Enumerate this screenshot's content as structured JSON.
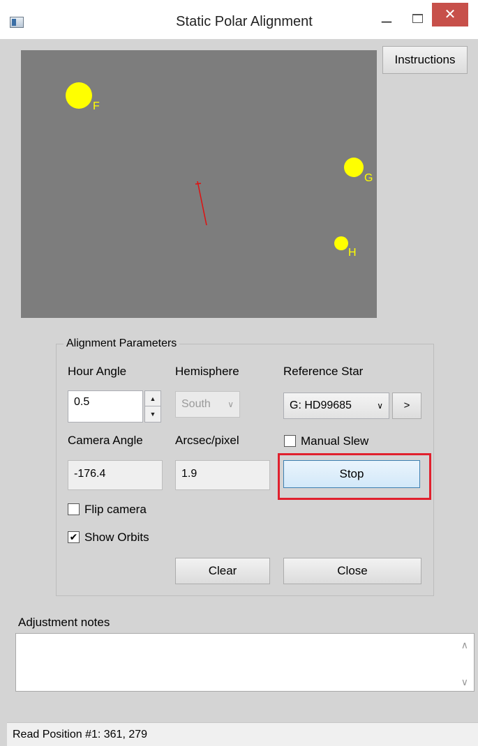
{
  "window": {
    "title": "Static Polar Alignment",
    "minimize_glyph": "–",
    "close_glyph": "✕"
  },
  "toolbar": {
    "instructions_label": "Instructions"
  },
  "preview": {
    "stars": [
      {
        "label": "F"
      },
      {
        "label": "G"
      },
      {
        "label": "H"
      }
    ],
    "colors": {
      "background": "#7d7d7d",
      "star": "#ffff00",
      "orbit_marker": "#e01010"
    }
  },
  "params": {
    "group_title": "Alignment Parameters",
    "hour_angle_label": "Hour Angle",
    "hour_angle_value": "0.5",
    "hemisphere_label": "Hemisphere",
    "hemisphere_value": "South",
    "reference_star_label": "Reference Star",
    "reference_star_value": "G: HD99685",
    "next_star_label": ">",
    "camera_angle_label": "Camera Angle",
    "camera_angle_value": "-176.4",
    "arcsec_label": "Arcsec/pixel",
    "arcsec_value": "1.9",
    "manual_slew_label": "Manual Slew",
    "manual_slew_checked": false,
    "flip_camera_label": "Flip camera",
    "flip_camera_checked": false,
    "show_orbits_label": "Show Orbits",
    "show_orbits_checked": true,
    "check_glyph": "✔"
  },
  "buttons": {
    "stop_label": "Stop",
    "clear_label": "Clear",
    "close_label": "Close"
  },
  "notes": {
    "label": "Adjustment notes",
    "value": ""
  },
  "status": {
    "text": "Read Position #1: 361, 279"
  }
}
